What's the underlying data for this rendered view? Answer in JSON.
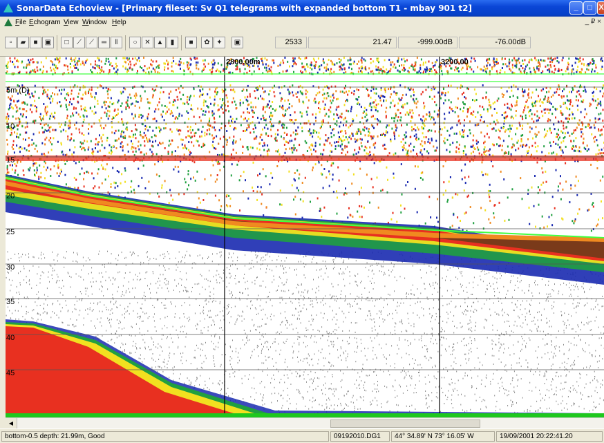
{
  "window": {
    "title": "SonarData Echoview - [Primary fileset: Sv Q1 telegrams with expanded bottom T1 - mbay 901 t2]",
    "min_glyph": "_",
    "max_glyph": "□",
    "close_glyph": "X"
  },
  "menu": {
    "items": [
      "File",
      "Echogram",
      "View",
      "Window",
      "Help"
    ],
    "doc_controls": "_ ₽ ×"
  },
  "toolbar": {
    "readouts": [
      "2533",
      "21.47",
      "-999.00dB",
      "-76.00dB"
    ]
  },
  "echogram": {
    "distance_labels": [
      "2800.00m",
      "3200.00"
    ],
    "depth_labels": [
      "5m (D)",
      "10",
      "15",
      "20",
      "25",
      "30",
      "35",
      "40",
      "45"
    ],
    "colors": {
      "brown": "#7a3a1a",
      "red": "#e83020",
      "orange": "#f08a20",
      "yellow": "#f2e020",
      "green": "#20a040",
      "blue": "#1a2ab0",
      "gray": "#8a8a8a",
      "line_green": "#40ff40"
    }
  },
  "statusbar": {
    "depth_info": "bottom-0.5 depth: 21.99m, Good",
    "file": "09192010.DG1",
    "position": "44° 34.89' N 73° 16.05' W",
    "datetime": "19/09/2001 20:22:41.20"
  }
}
